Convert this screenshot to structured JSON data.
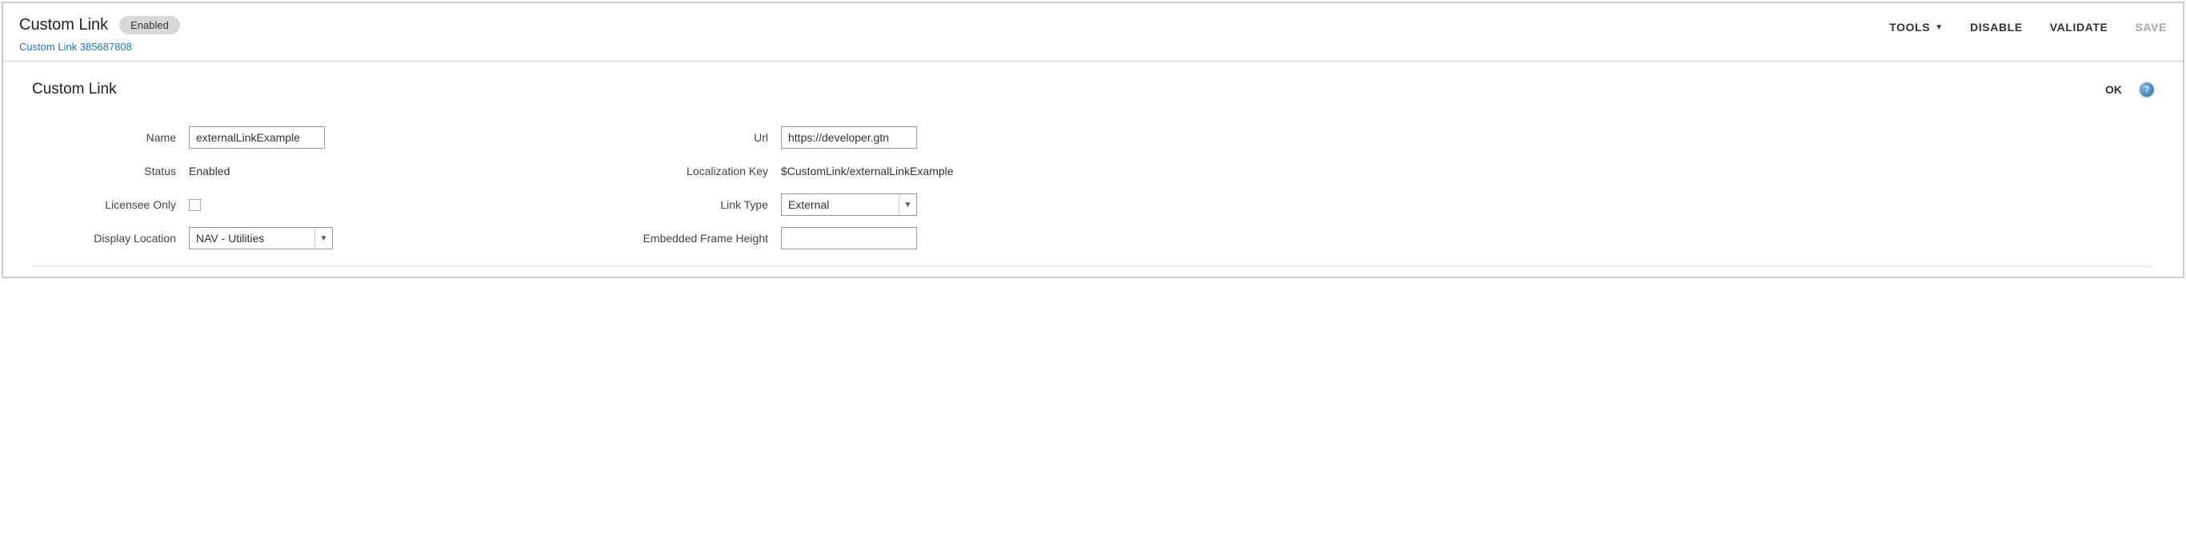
{
  "header": {
    "title": "Custom Link",
    "status_badge": "Enabled",
    "breadcrumb": "Custom Link 385687808",
    "toolbar": {
      "tools": "TOOLS",
      "disable": "DISABLE",
      "validate": "VALIDATE",
      "save": "SAVE"
    }
  },
  "section": {
    "title": "Custom Link",
    "ok_label": "OK"
  },
  "form": {
    "left": {
      "name_label": "Name",
      "name_value": "externalLinkExample",
      "status_label": "Status",
      "status_value": "Enabled",
      "licensee_label": "Licensee Only",
      "licensee_checked": false,
      "display_location_label": "Display Location",
      "display_location_value": "NAV - Utilities"
    },
    "right": {
      "url_label": "Url",
      "url_value": "https://developer.gtn",
      "localization_key_label": "Localization Key",
      "localization_key_value": "$CustomLink/externalLinkExample",
      "link_type_label": "Link Type",
      "link_type_value": "External",
      "frame_height_label": "Embedded Frame Height",
      "frame_height_value": ""
    }
  }
}
